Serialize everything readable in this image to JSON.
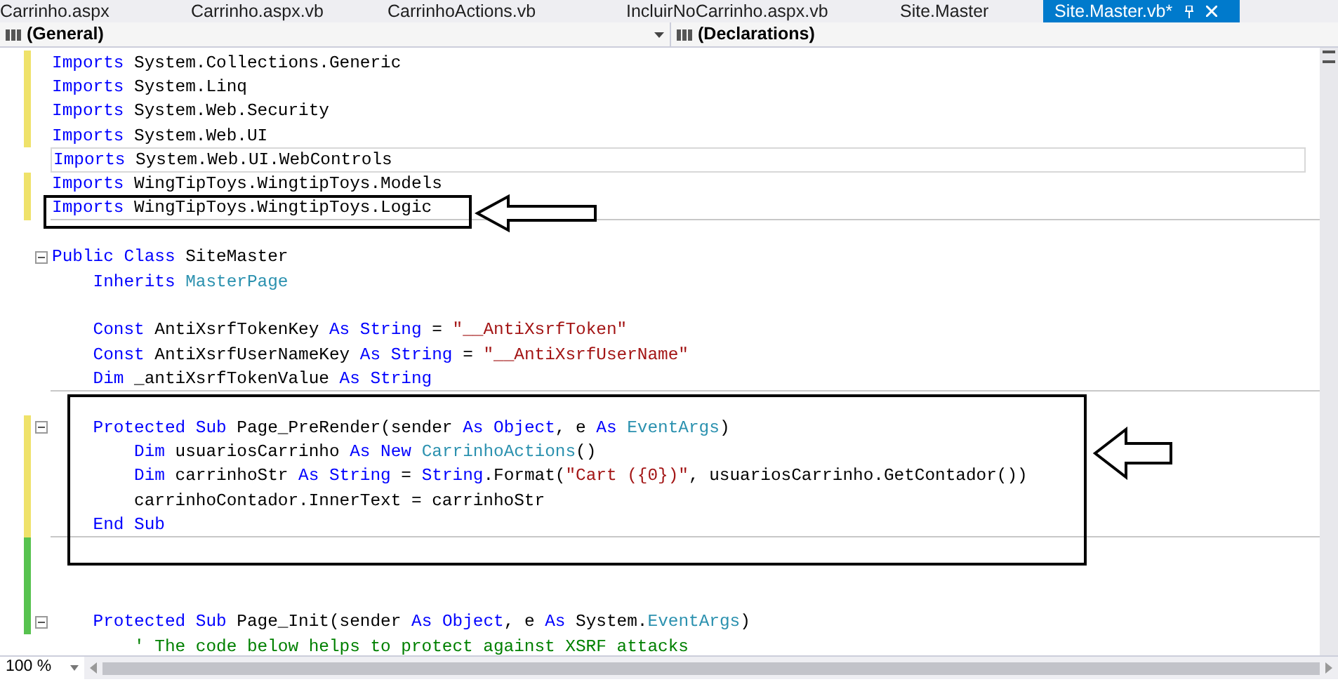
{
  "tabs": [
    {
      "label": "Carrinho.aspx",
      "selected": false
    },
    {
      "label": "Carrinho.aspx.vb",
      "selected": false
    },
    {
      "label": "CarrinhoActions.vb",
      "selected": false
    },
    {
      "label": "IncluirNoCarrinho.aspx.vb",
      "selected": false
    },
    {
      "label": "Site.Master",
      "selected": false
    },
    {
      "label": "Site.Master.vb*",
      "selected": true
    }
  ],
  "navigation_bar": {
    "type_dropdown": "(General)",
    "member_dropdown": "(Declarations)"
  },
  "code_lines": [
    {
      "kind": "code",
      "changed": true,
      "segments": [
        {
          "kind": "kw",
          "text": "Imports"
        },
        {
          "kind": "plain",
          "text": " System.Collections.Generic"
        }
      ]
    },
    {
      "kind": "code",
      "changed": true,
      "segments": [
        {
          "kind": "kw",
          "text": "Imports"
        },
        {
          "kind": "plain",
          "text": " System.Linq"
        }
      ]
    },
    {
      "kind": "code",
      "changed": true,
      "segments": [
        {
          "kind": "kw",
          "text": "Imports"
        },
        {
          "kind": "plain",
          "text": " System.Web.Security"
        }
      ]
    },
    {
      "kind": "code",
      "changed": true,
      "segments": [
        {
          "kind": "kw",
          "text": "Imports"
        },
        {
          "kind": "plain",
          "text": " System.Web.UI"
        }
      ]
    },
    {
      "kind": "code",
      "current": true,
      "segments": [
        {
          "kind": "kw",
          "text": "Imports"
        },
        {
          "kind": "plain",
          "text": " System.Web.UI.WebControls"
        }
      ]
    },
    {
      "kind": "code",
      "changed": true,
      "segments": [
        {
          "kind": "kw",
          "text": "Imports"
        },
        {
          "kind": "plain",
          "text": " WingTipToys.WingtipToys.Models"
        }
      ]
    },
    {
      "kind": "code",
      "changed": true,
      "separator_after": true,
      "segments": [
        {
          "kind": "kw",
          "text": "Imports"
        },
        {
          "kind": "plain",
          "text": " WingTipToys.WingtipToys.Logic"
        }
      ]
    },
    {
      "kind": "blank"
    },
    {
      "kind": "code",
      "fold": true,
      "segments": [
        {
          "kind": "kw",
          "text": "Public Class"
        },
        {
          "kind": "plain",
          "text": " SiteMaster"
        }
      ]
    },
    {
      "kind": "code",
      "segments": [
        {
          "kind": "kw",
          "text": "    Inherits"
        },
        {
          "kind": "type",
          "text": " MasterPage"
        }
      ]
    },
    {
      "kind": "blank"
    },
    {
      "kind": "code",
      "segments": [
        {
          "kind": "kw",
          "text": "    Const"
        },
        {
          "kind": "plain",
          "text": " AntiXsrfTokenKey "
        },
        {
          "kind": "kw",
          "text": "As String"
        },
        {
          "kind": "plain",
          "text": " = "
        },
        {
          "kind": "str",
          "text": "\"__AntiXsrfToken\""
        }
      ]
    },
    {
      "kind": "code",
      "segments": [
        {
          "kind": "kw",
          "text": "    Const"
        },
        {
          "kind": "plain",
          "text": " AntiXsrfUserNameKey "
        },
        {
          "kind": "kw",
          "text": "As String"
        },
        {
          "kind": "plain",
          "text": " = "
        },
        {
          "kind": "str",
          "text": "\"__AntiXsrfUserName\""
        }
      ]
    },
    {
      "kind": "code",
      "separator_after": true,
      "segments": [
        {
          "kind": "kw",
          "text": "    Dim"
        },
        {
          "kind": "plain",
          "text": " _antiXsrfTokenValue "
        },
        {
          "kind": "kw",
          "text": "As String"
        }
      ]
    },
    {
      "kind": "blank"
    },
    {
      "kind": "code",
      "changed": true,
      "fold": true,
      "segments": [
        {
          "kind": "kw",
          "text": "    Protected Sub"
        },
        {
          "kind": "plain",
          "text": " Page_PreRender(sender "
        },
        {
          "kind": "kw",
          "text": "As Object"
        },
        {
          "kind": "plain",
          "text": ", e "
        },
        {
          "kind": "kw",
          "text": "As"
        },
        {
          "kind": "type",
          "text": " EventArgs"
        },
        {
          "kind": "plain",
          "text": ")"
        }
      ]
    },
    {
      "kind": "code",
      "changed": true,
      "segments": [
        {
          "kind": "kw",
          "text": "        Dim"
        },
        {
          "kind": "plain",
          "text": " usuariosCarrinho "
        },
        {
          "kind": "kw",
          "text": "As New"
        },
        {
          "kind": "type",
          "text": " CarrinhoActions"
        },
        {
          "kind": "plain",
          "text": "()"
        }
      ]
    },
    {
      "kind": "code",
      "changed": true,
      "segments": [
        {
          "kind": "kw",
          "text": "        Dim"
        },
        {
          "kind": "plain",
          "text": " carrinhoStr "
        },
        {
          "kind": "kw",
          "text": "As String"
        },
        {
          "kind": "plain",
          "text": " = "
        },
        {
          "kind": "kw",
          "text": "String"
        },
        {
          "kind": "plain",
          "text": ".Format("
        },
        {
          "kind": "str",
          "text": "\"Cart ({0})\""
        },
        {
          "kind": "plain",
          "text": ", usuariosCarrinho.GetContador())"
        }
      ]
    },
    {
      "kind": "code",
      "changed": true,
      "segments": [
        {
          "kind": "plain",
          "text": "        carrinhoContador.InnerText = carrinhoStr"
        }
      ]
    },
    {
      "kind": "code",
      "changed": true,
      "separator_after": true,
      "segments": [
        {
          "kind": "kw",
          "text": "    End Sub"
        }
      ]
    },
    {
      "kind": "blank",
      "saved": true
    },
    {
      "kind": "blank",
      "saved": true
    },
    {
      "kind": "blank",
      "saved": true
    },
    {
      "kind": "code",
      "saved": true,
      "fold": true,
      "segments": [
        {
          "kind": "kw",
          "text": "    Protected Sub"
        },
        {
          "kind": "plain",
          "text": " Page_Init(sender "
        },
        {
          "kind": "kw",
          "text": "As Object"
        },
        {
          "kind": "plain",
          "text": ", e "
        },
        {
          "kind": "kw",
          "text": "As"
        },
        {
          "kind": "plain",
          "text": " System."
        },
        {
          "kind": "type",
          "text": "EventArgs"
        },
        {
          "kind": "plain",
          "text": ")"
        }
      ]
    },
    {
      "kind": "code",
      "segments": [
        {
          "kind": "com",
          "text": "        ' The code below helps to protect against XSRF attacks"
        }
      ]
    }
  ],
  "zoom": "100 %"
}
